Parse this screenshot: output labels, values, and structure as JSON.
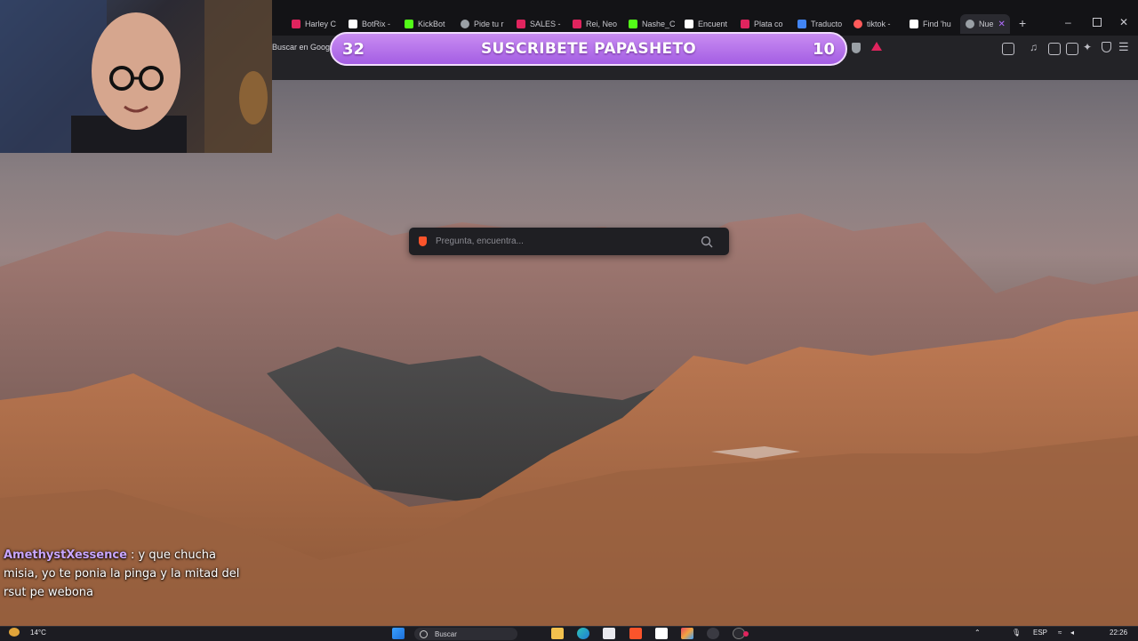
{
  "tabs": [
    {
      "label": "Harley C",
      "color": "#e0245e"
    },
    {
      "label": "BotRix -",
      "color": "#ffffff"
    },
    {
      "label": "KickBot",
      "color": "#53fc18"
    },
    {
      "label": "Pide tu r",
      "color": "#9aa0a6"
    },
    {
      "label": "SALES -",
      "color": "#e0245e"
    },
    {
      "label": "Rei, Neo",
      "color": "#e0245e"
    },
    {
      "label": "Nashe_C",
      "color": "#53fc18"
    },
    {
      "label": "Encuent",
      "color": "#ffffff"
    },
    {
      "label": "Plata co",
      "color": "#e0245e"
    },
    {
      "label": "Traducto",
      "color": "#4285f4"
    },
    {
      "label": "tiktok -",
      "color": "#ff5a5a"
    },
    {
      "label": "Find 'hu",
      "color": "#ffffff"
    },
    {
      "label": "Nue",
      "color": "#9aa0a6"
    }
  ],
  "toolbar": {
    "address_text": "Buscar en Goog"
  },
  "banner": {
    "left_count": "32",
    "text": "SUSCRIBETE PAPASHETO",
    "right_count": "10"
  },
  "search": {
    "placeholder": "Pregunta, encuentra..."
  },
  "chat": {
    "username": "AmethystXessence",
    "message": " : y que chucha misia, yo te ponia la pinga y la mitad del rsut pe webona"
  },
  "taskbar": {
    "weather": "14°C",
    "search_label": "Buscar",
    "language": "ESP",
    "time": "22:26"
  },
  "colors": {
    "banner_purple": "#a45ee3",
    "chat_username": "#c9a6ff",
    "brave_orange": "#fb542b"
  }
}
